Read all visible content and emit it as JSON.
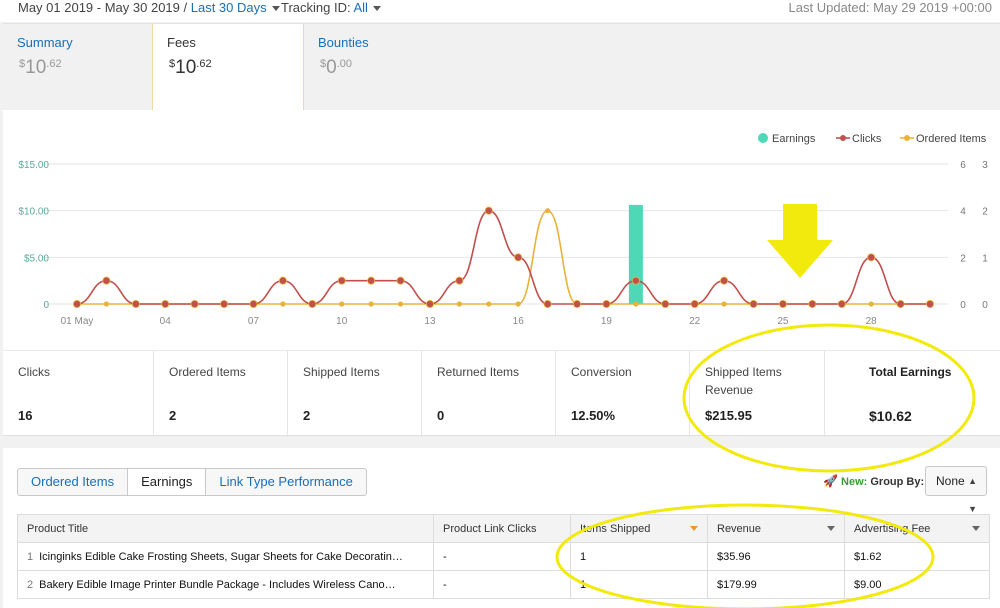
{
  "topbar": {
    "date_range": "May 01 2019 - May 30 2019 /",
    "range_preset": "Last 30 Days",
    "tracking_label": "Tracking ID:",
    "tracking_value": "All",
    "last_updated": "Last Updated: May 29 2019 +00:00"
  },
  "tabs": [
    {
      "label": "Summary",
      "currency": "$",
      "whole": "10",
      "cents": ".62"
    },
    {
      "label": "Fees",
      "currency": "$",
      "whole": "10",
      "cents": ".62"
    },
    {
      "label": "Bounties",
      "currency": "$",
      "whole": "0",
      "cents": ".00"
    }
  ],
  "chart_data": {
    "type": "line",
    "x": [
      "01 May",
      "02",
      "03",
      "04",
      "05",
      "06",
      "07",
      "08",
      "09",
      "10",
      "11",
      "12",
      "13",
      "14",
      "15",
      "16",
      "17",
      "18",
      "19",
      "20",
      "21",
      "22",
      "23",
      "24",
      "25",
      "26",
      "27",
      "28",
      "29",
      "30"
    ],
    "xtick_labels": [
      "01 May",
      "04",
      "07",
      "10",
      "13",
      "16",
      "19",
      "22",
      "25",
      "28"
    ],
    "xtick_indices": [
      0,
      3,
      6,
      9,
      12,
      15,
      18,
      21,
      24,
      27
    ],
    "left_axis": {
      "ticks": [
        "0",
        "$5.00",
        "$10.00",
        "$15.00"
      ],
      "values": [
        0,
        5,
        10,
        15
      ],
      "ylim": [
        0,
        15
      ],
      "color": "#5aaa9b"
    },
    "right_axis_1": {
      "ticks": [
        "0",
        "2",
        "4",
        "6"
      ],
      "values": [
        0,
        2,
        4,
        6
      ],
      "ylim": [
        0,
        6
      ]
    },
    "right_axis_2": {
      "ticks": [
        "0",
        "1",
        "2",
        "3"
      ],
      "values": [
        0,
        1,
        2,
        3
      ],
      "ylim": [
        0,
        3
      ]
    },
    "legend_position": "top-right",
    "grid": true,
    "series": [
      {
        "name": "Earnings",
        "kind": "bar",
        "axis": "left",
        "color": "#4fd8b5",
        "values": [
          0,
          0,
          0,
          0,
          0,
          0,
          0,
          0,
          0,
          0,
          0,
          0,
          0,
          0,
          0,
          0,
          0,
          0,
          0,
          10.62,
          0,
          0,
          0,
          0,
          0,
          0,
          0,
          0,
          0,
          0
        ]
      },
      {
        "name": "Clicks",
        "kind": "line",
        "axis": "right_axis_1",
        "color": "#c0504d",
        "values": [
          0,
          1,
          0,
          0,
          0,
          0,
          0,
          1,
          0,
          1,
          1,
          1,
          0,
          1,
          4,
          2,
          0,
          0,
          0,
          1,
          0,
          0,
          1,
          0,
          0,
          0,
          0,
          2,
          0,
          0
        ]
      },
      {
        "name": "Ordered Items",
        "kind": "line",
        "axis": "right_axis_2",
        "color": "#e8b33a",
        "values": [
          0,
          0,
          0,
          0,
          0,
          0,
          0,
          0,
          0,
          0,
          0,
          0,
          0,
          0,
          0,
          0,
          2,
          0,
          0,
          0,
          0,
          0,
          0,
          0,
          0,
          0,
          0,
          0,
          0,
          0
        ]
      }
    ]
  },
  "metrics": [
    {
      "label": "Clicks",
      "value": "16"
    },
    {
      "label": "Ordered Items",
      "value": "2"
    },
    {
      "label": "Shipped Items",
      "value": "2"
    },
    {
      "label": "Returned Items",
      "value": "0"
    },
    {
      "label": "Conversion",
      "value": "12.50%"
    },
    {
      "label": "Shipped Items Revenue",
      "value": "$215.95"
    },
    {
      "label": "Total Earnings",
      "value": "$10.62"
    }
  ],
  "report_tabs": [
    "Ordered Items",
    "Earnings",
    "Link Type Performance"
  ],
  "groupby": {
    "new_label": "New:",
    "label": "Group By:",
    "selected": "None"
  },
  "table": {
    "headers": [
      "Product Title",
      "Product Link Clicks",
      "Items Shipped",
      "Revenue",
      "Advertising Fee"
    ],
    "rows": [
      {
        "index": "1",
        "title": "Icinginks Edible Cake Frosting Sheets, Sugar Sheets for Cake Decoratin…",
        "clicks": "-",
        "shipped": "1",
        "revenue": "$35.96",
        "fee": "$1.62"
      },
      {
        "index": "2",
        "title": "Bakery Edible Image Printer Bundle Package - Includes Wireless Cano…",
        "clicks": "-",
        "shipped": "1",
        "revenue": "$179.99",
        "fee": "$9.00"
      }
    ]
  },
  "annotation_color": "#f2ea0c"
}
